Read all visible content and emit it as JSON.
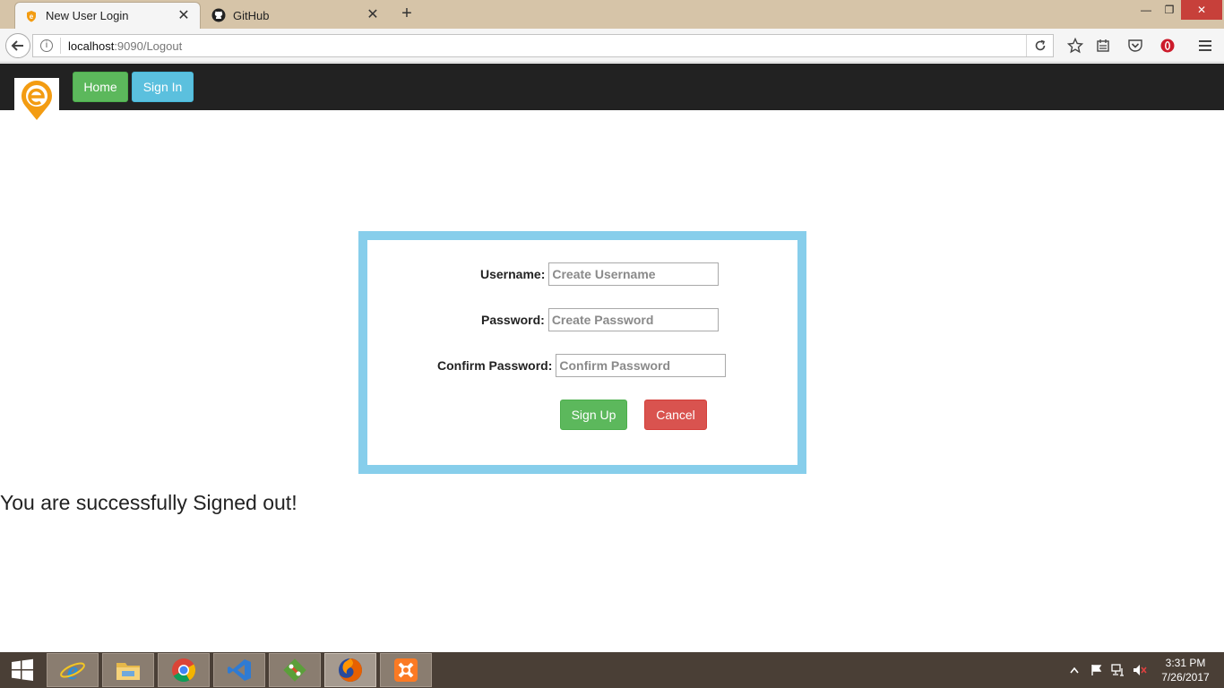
{
  "browser": {
    "tabs": [
      {
        "title": "New User Login",
        "active": true,
        "icon": "tab-favicon-icon"
      },
      {
        "title": "GitHub",
        "active": false,
        "icon": "github-icon"
      }
    ],
    "url": {
      "host": "localhost",
      "rest": ":9090/Logout"
    },
    "colors": {
      "tabbar": "#d6c4a8",
      "close": "#c7403a"
    }
  },
  "header": {
    "home_label": "Home",
    "signin_label": "Sign In",
    "colors": {
      "bar": "#222222",
      "home": "#5cb85c",
      "signin": "#5bc0de",
      "logo": "#f39c12"
    }
  },
  "form": {
    "username": {
      "label": "Username:",
      "placeholder": "Create Username",
      "value": ""
    },
    "password": {
      "label": "Password:",
      "placeholder": "Create Password",
      "value": ""
    },
    "confirm": {
      "label": "Confirm Password:",
      "placeholder": "Confirm Password",
      "value": ""
    },
    "signup_label": "Sign Up",
    "cancel_label": "Cancel",
    "colors": {
      "border": "#87ceeb",
      "signup": "#5cb85c",
      "cancel": "#d9534f"
    }
  },
  "message": "You are successfully Signed out!",
  "taskbar": {
    "apps": [
      "internet-explorer-icon",
      "file-explorer-icon",
      "chrome-icon",
      "visual-studio-icon",
      "git-icon",
      "firefox-icon",
      "xampp-icon"
    ],
    "clock": {
      "time": "3:31 PM",
      "date": "7/26/2017"
    }
  }
}
